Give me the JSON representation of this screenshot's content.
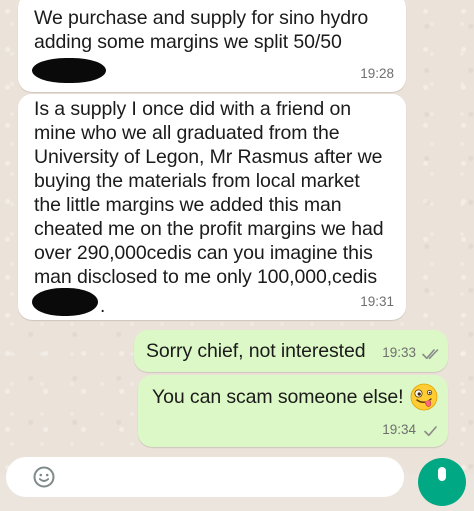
{
  "conversation": {
    "messages": [
      {
        "direction": "incoming",
        "text": "We purchase and supply for sino hydro\nadding some margins we split 50/50",
        "time": "19:28",
        "redacted_name": true
      },
      {
        "direction": "incoming",
        "text": "Is a supply I once did with a friend on\nmine who we all graduated from the\nUniversity of Legon, Mr Rasmus after we\nbuying the materials from local market\nthe little margins we added this man\ncheated me on the profit margins we had\nover 290,000cedis can you imagine this\nman disclosed to me only 100,000,cedis",
        "trailing_mark": ".",
        "time": "19:31",
        "redacted_name": true
      },
      {
        "direction": "outgoing",
        "text": "Sorry chief, not interested",
        "time": "19:33",
        "status_icon": "double-check-icon"
      },
      {
        "direction": "outgoing",
        "text": "You can scam someone else!",
        "emoji": "zany-face-emoji",
        "time": "19:34",
        "status_icon": "single-check-icon"
      }
    ]
  },
  "composer": {
    "left_icon": "emoji-icon",
    "right_icon": "mic-icon"
  },
  "colors": {
    "incoming_bubble": "#ffffff",
    "outgoing_bubble": "#dcf8c6",
    "wallpaper": "#ebe3d9",
    "accent": "#00a884",
    "timestamp": "#6f6f6f"
  }
}
